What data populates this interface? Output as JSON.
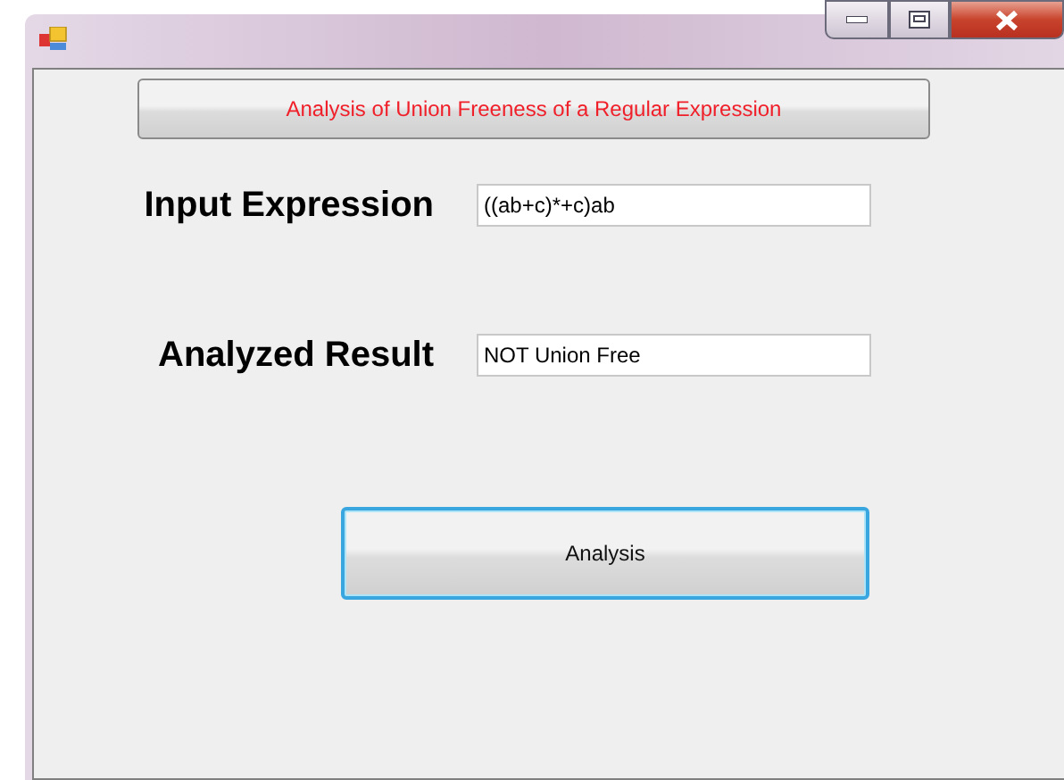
{
  "title_button": {
    "label": "Analysis of Union Freeness of a Regular Expression"
  },
  "fields": [
    {
      "label": "Input Expression",
      "value": "((ab+c)*+c)ab"
    },
    {
      "label": "Analyzed Result",
      "value": "NOT Union Free"
    }
  ],
  "action_button": {
    "label": "Analysis",
    "focused": true
  }
}
